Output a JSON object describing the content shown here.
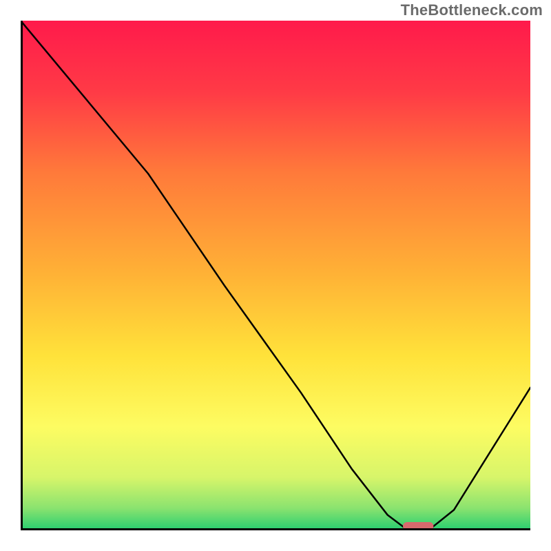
{
  "watermark": "TheBottleneck.com",
  "chart_data": {
    "type": "line",
    "title": "",
    "xlabel": "",
    "ylabel": "",
    "xlim": [
      0,
      100
    ],
    "ylim": [
      0,
      100
    ],
    "grid": false,
    "legend": false,
    "series": [
      {
        "name": "bottleneck-curve",
        "x": [
          0,
          10,
          25,
          40,
          55,
          65,
          72,
          76,
          80,
          85,
          90,
          95,
          100
        ],
        "values": [
          100,
          88,
          70,
          48,
          27,
          12,
          3,
          0,
          0,
          4,
          12,
          20,
          28
        ]
      }
    ],
    "optimal_marker": {
      "x": 78,
      "width": 6,
      "color": "#d86a6d"
    },
    "background_gradient": {
      "stops": [
        {
          "pct": 0,
          "color": "#ff1a4b"
        },
        {
          "pct": 14,
          "color": "#ff3a46"
        },
        {
          "pct": 30,
          "color": "#ff7a3a"
        },
        {
          "pct": 50,
          "color": "#ffb236"
        },
        {
          "pct": 66,
          "color": "#ffe23a"
        },
        {
          "pct": 80,
          "color": "#fdfc62"
        },
        {
          "pct": 90,
          "color": "#d7f56a"
        },
        {
          "pct": 96,
          "color": "#8be36f"
        },
        {
          "pct": 100,
          "color": "#2fd070"
        }
      ]
    }
  }
}
